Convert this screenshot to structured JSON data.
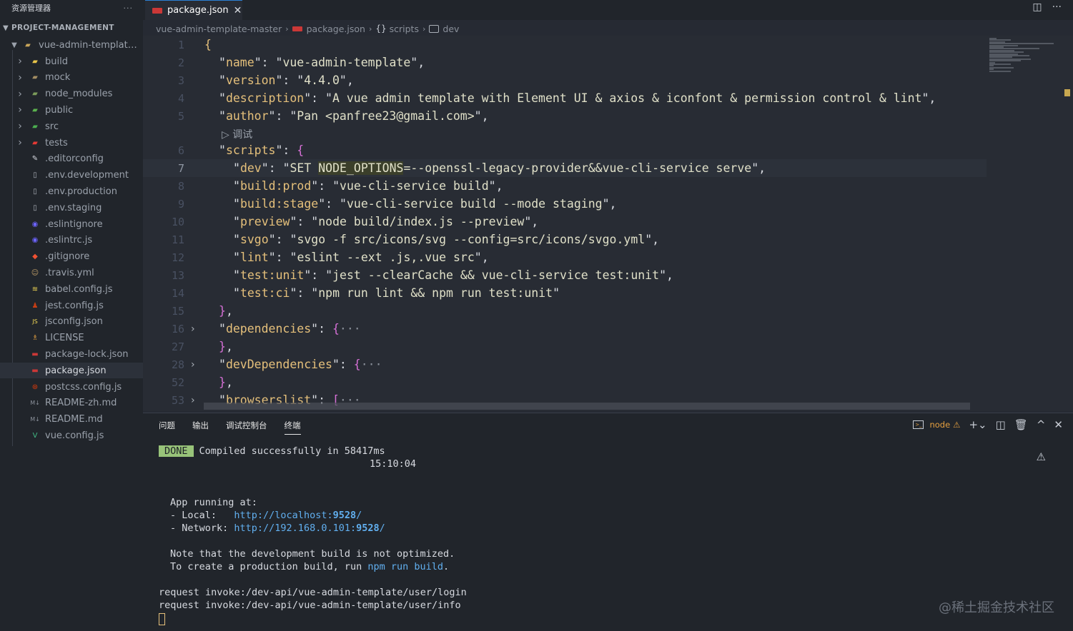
{
  "sidebar": {
    "title": "资源管理器",
    "more": "···",
    "project": "PROJECT-MANAGEMENT",
    "root_folder": "vue-admin-template-...",
    "items": [
      {
        "label": "build",
        "kind": "folder",
        "icon": "folder-yellow-icon",
        "color": "#e8c54a"
      },
      {
        "label": "mock",
        "kind": "folder",
        "icon": "folder-mock-icon",
        "color": "#a48e63"
      },
      {
        "label": "node_modules",
        "kind": "folder",
        "icon": "folder-node-icon",
        "color": "#7b9b5a"
      },
      {
        "label": "public",
        "kind": "folder",
        "icon": "folder-public-icon",
        "color": "#5bb24e"
      },
      {
        "label": "src",
        "kind": "folder",
        "icon": "folder-src-icon",
        "color": "#4caf50"
      },
      {
        "label": "tests",
        "kind": "folder",
        "icon": "folder-tests-icon",
        "color": "#e53935"
      },
      {
        "label": ".editorconfig",
        "kind": "file",
        "icon": "editorconfig-icon",
        "color": "#d7dae0"
      },
      {
        "label": ".env.development",
        "kind": "file",
        "icon": "file-icon",
        "color": "#aab0b8"
      },
      {
        "label": ".env.production",
        "kind": "file",
        "icon": "file-icon",
        "color": "#aab0b8"
      },
      {
        "label": ".env.staging",
        "kind": "file",
        "icon": "file-icon",
        "color": "#aab0b8"
      },
      {
        "label": ".eslintignore",
        "kind": "file",
        "icon": "eslint-icon",
        "color": "#6c63ff"
      },
      {
        "label": ".eslintrc.js",
        "kind": "file",
        "icon": "eslint-icon",
        "color": "#6c63ff"
      },
      {
        "label": ".gitignore",
        "kind": "file",
        "icon": "git-icon",
        "color": "#f05133"
      },
      {
        "label": ".travis.yml",
        "kind": "file",
        "icon": "travis-icon",
        "color": "#c2a06a"
      },
      {
        "label": "babel.config.js",
        "kind": "file",
        "icon": "babel-icon",
        "color": "#f5da55"
      },
      {
        "label": "jest.config.js",
        "kind": "file",
        "icon": "jest-icon",
        "color": "#c63d14"
      },
      {
        "label": "jsconfig.json",
        "kind": "file",
        "icon": "js-icon",
        "color": "#f5da55"
      },
      {
        "label": "LICENSE",
        "kind": "file",
        "icon": "license-icon",
        "color": "#e5a040"
      },
      {
        "label": "package-lock.json",
        "kind": "file",
        "icon": "npm-icon",
        "color": "#cb3837"
      },
      {
        "label": "package.json",
        "kind": "file",
        "icon": "npm-icon",
        "color": "#cb3837",
        "selected": true
      },
      {
        "label": "postcss.config.js",
        "kind": "file",
        "icon": "postcss-icon",
        "color": "#dd3a0a"
      },
      {
        "label": "README-zh.md",
        "kind": "file",
        "icon": "markdown-icon",
        "color": "#8a909a"
      },
      {
        "label": "README.md",
        "kind": "file",
        "icon": "markdown-icon",
        "color": "#8a909a"
      },
      {
        "label": "vue.config.js",
        "kind": "file",
        "icon": "vue-icon",
        "color": "#41b883"
      }
    ]
  },
  "tab": {
    "label": "package.json",
    "close": "✕"
  },
  "breadcrumb": {
    "root": "vue-admin-template-master",
    "file": "package.json",
    "scripts": "scripts",
    "dev": "dev"
  },
  "editor": {
    "codelens": "调试",
    "lines": [
      {
        "n": "1",
        "text": "{"
      },
      {
        "n": "2",
        "text": "\"name\": \"vue-admin-template\","
      },
      {
        "n": "3",
        "text": "\"version\": \"4.4.0\","
      },
      {
        "n": "4",
        "text": "\"description\": \"A vue admin template with Element UI & axios & iconfont & permission control & lint\","
      },
      {
        "n": "5",
        "text": "\"author\": \"Pan <panfree23@gmail.com>\","
      },
      {
        "n": "6",
        "text": "\"scripts\": {"
      },
      {
        "n": "7",
        "text": "\"dev\": \"SET NODE_OPTIONS=--openssl-legacy-provider&&vue-cli-service serve\","
      },
      {
        "n": "8",
        "text": "\"build:prod\": \"vue-cli-service build\","
      },
      {
        "n": "9",
        "text": "\"build:stage\": \"vue-cli-service build --mode staging\","
      },
      {
        "n": "10",
        "text": "\"preview\": \"node build/index.js --preview\","
      },
      {
        "n": "11",
        "text": "\"svgo\": \"svgo -f src/icons/svg --config=src/icons/svgo.yml\","
      },
      {
        "n": "12",
        "text": "\"lint\": \"eslint --ext .js,.vue src\","
      },
      {
        "n": "13",
        "text": "\"test:unit\": \"jest --clearCache && vue-cli-service test:unit\","
      },
      {
        "n": "14",
        "text": "\"test:ci\": \"npm run lint && npm run test:unit\""
      },
      {
        "n": "15",
        "text": "},"
      },
      {
        "n": "16",
        "text": "\"dependencies\": {···"
      },
      {
        "n": "27",
        "text": "},"
      },
      {
        "n": "28",
        "text": "\"devDependencies\": {···"
      },
      {
        "n": "52",
        "text": "},"
      },
      {
        "n": "53",
        "text": "\"browserslist\": [···"
      }
    ]
  },
  "panel": {
    "tabs": [
      "问题",
      "输出",
      "调试控制台",
      "终端"
    ],
    "active_tab": "终端",
    "terminal_name": "node",
    "terminal": {
      "done": "DONE",
      "compiled": "Compiled successfully in 58417ms",
      "time": "15:10:04",
      "app_running": "App running at:",
      "local_label": "- Local:   ",
      "local_url_pre": "http://localhost:",
      "local_port": "9528",
      "local_url_post": "/",
      "network_label": "- Network: ",
      "network_url_pre": "http://192.168.0.101:",
      "network_port": "9528",
      "network_url_post": "/",
      "note1": "Note that the development build is not optimized.",
      "note2_pre": "To create a production build, run ",
      "note2_cmd": "npm run build",
      "note2_post": ".",
      "req1": "request invoke:/dev-api/vue-admin-template/user/login",
      "req2": "request invoke:/dev-api/vue-admin-template/user/info"
    }
  },
  "watermark": "@稀土掘金技术社区",
  "colors": {
    "accent": "#2b7fd3",
    "string": "#e0e0c8",
    "key_bracket": "#e5c07b",
    "brace": "#d670d6",
    "done": "#98c379",
    "warning": "#e5a040"
  }
}
